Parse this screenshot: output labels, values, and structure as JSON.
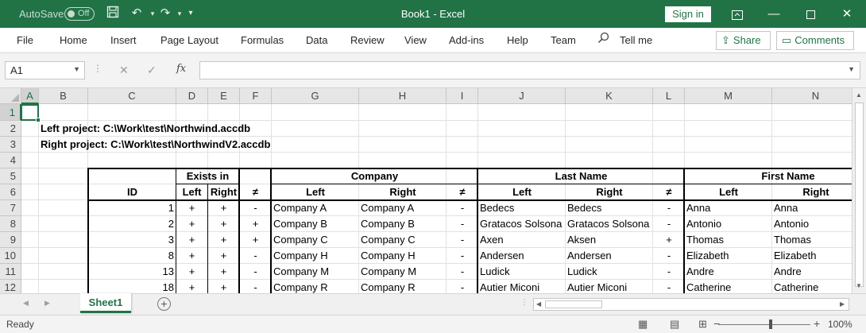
{
  "titlebar": {
    "autosave_label": "AutoSave",
    "autosave_state": "Off",
    "title": "Book1  -  Excel",
    "signin_label": "Sign in",
    "icons": [
      "save-icon",
      "undo-icon",
      "redo-icon",
      "customize-qat-icon",
      "ribbon-display-icon",
      "minimize-icon",
      "maximize-icon",
      "close-icon"
    ]
  },
  "ribbon": {
    "tabs": [
      "File",
      "Home",
      "Insert",
      "Page Layout",
      "Formulas",
      "Data",
      "Review",
      "View",
      "Add-ins",
      "Help",
      "Team"
    ],
    "tell_me": "Tell me",
    "share_label": "Share",
    "comments_label": "Comments"
  },
  "formula_bar": {
    "name_box": "A1",
    "formula": ""
  },
  "columns": [
    "A",
    "B",
    "C",
    "D",
    "E",
    "F",
    "G",
    "H",
    "I",
    "J",
    "K",
    "L",
    "M",
    "N"
  ],
  "rows": [
    "1",
    "2",
    "3",
    "4",
    "5",
    "6",
    "7",
    "8",
    "9",
    "10",
    "11",
    "12"
  ],
  "selected_cell": "A1",
  "sheet": {
    "row2_text": "Left project: C:\\Work\\test\\Northwind.accdb",
    "row3_text": "Right project: C:\\Work\\test\\NorthwindV2.accdb",
    "headers": {
      "id": "ID",
      "exists_in": "Exists in",
      "company": "Company",
      "last_name": "Last Name",
      "first_name": "First Name",
      "left": "Left",
      "right": "Right",
      "neq": "≠"
    },
    "data_rows": [
      {
        "id": "1",
        "exL": "+",
        "exR": "+",
        "exD": "-",
        "compL": "Company A",
        "compR": "Company A",
        "compD": "-",
        "lnL": "Bedecs",
        "lnR": "Bedecs",
        "lnD": "-",
        "fnL": "Anna",
        "fnR": "Anna"
      },
      {
        "id": "2",
        "exL": "+",
        "exR": "+",
        "exD": "+",
        "compL": "Company B",
        "compR": "Company B",
        "compD": "-",
        "lnL": "Gratacos Solsona",
        "lnR": "Gratacos Solsona",
        "lnD": "-",
        "fnL": "Antonio",
        "fnR": "Antonio"
      },
      {
        "id": "3",
        "exL": "+",
        "exR": "+",
        "exD": "+",
        "compL": "Company C",
        "compR": "Company C",
        "compD": "-",
        "lnL": "Axen",
        "lnR": "Aksen",
        "lnD": "+",
        "fnL": "Thomas",
        "fnR": "Thomas"
      },
      {
        "id": "8",
        "exL": "+",
        "exR": "+",
        "exD": "-",
        "compL": "Company H",
        "compR": "Company H",
        "compD": "-",
        "lnL": "Andersen",
        "lnR": "Andersen",
        "lnD": "-",
        "fnL": "Elizabeth",
        "fnR": "Elizabeth"
      },
      {
        "id": "13",
        "exL": "+",
        "exR": "+",
        "exD": "-",
        "compL": "Company M",
        "compR": "Company M",
        "compD": "-",
        "lnL": "Ludick",
        "lnR": "Ludick",
        "lnD": "-",
        "fnL": "Andre",
        "fnR": "Andre"
      },
      {
        "id": "18",
        "exL": "+",
        "exR": "+",
        "exD": "-",
        "compL": "Company R",
        "compR": "Company R",
        "compD": "-",
        "lnL": "Autier Miconi",
        "lnR": "Autier Miconi",
        "lnD": "-",
        "fnL": "Catherine",
        "fnR": "Catherine"
      }
    ]
  },
  "sheet_tab": "Sheet1",
  "status": {
    "ready": "Ready",
    "zoom": "100%"
  },
  "colors": {
    "accent": "#217346"
  }
}
